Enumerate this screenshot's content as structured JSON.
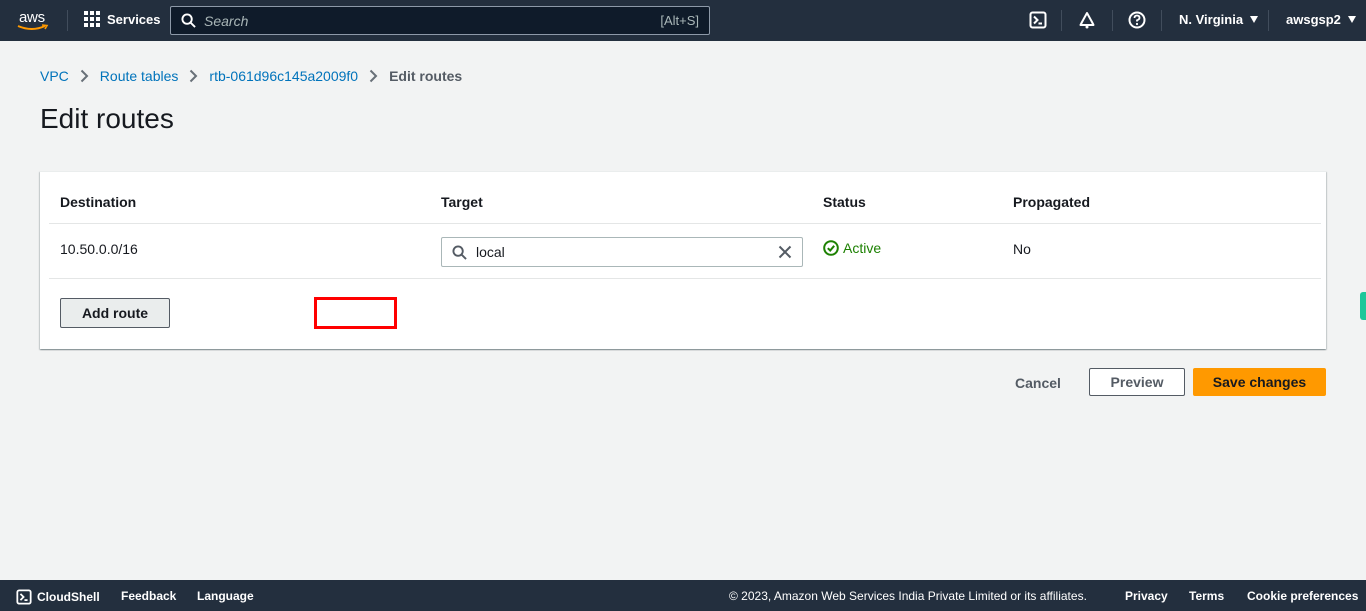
{
  "topnav": {
    "logo_text": "aws",
    "services_label": "Services",
    "search_placeholder": "Search",
    "search_shortcut": "[Alt+S]",
    "icons": [
      "cloudshell-icon",
      "notifications-icon",
      "help-icon"
    ],
    "region_label": "N. Virginia",
    "account_label": "awsgsp2"
  },
  "breadcrumb": {
    "items": [
      "VPC",
      "Route tables",
      "rtb-061d96c145a2009f0"
    ],
    "current": "Edit routes"
  },
  "page": {
    "title": "Edit routes"
  },
  "routes_table": {
    "columns": [
      "Destination",
      "Target",
      "Status",
      "Propagated"
    ],
    "rows": [
      {
        "destination": "10.50.0.0/16",
        "target": "local",
        "status": "Active",
        "propagated": "No"
      }
    ],
    "add_route_label": "Add route"
  },
  "actions": {
    "cancel_label": "Cancel",
    "preview_label": "Preview",
    "save_label": "Save changes"
  },
  "colors": {
    "nav_bg": "#232f3e",
    "link": "#0073bb",
    "status_active": "#1d8102",
    "primary_button": "#ff9900",
    "highlight_box": "#ff0000"
  },
  "footer": {
    "cloudshell_label": "CloudShell",
    "feedback_label": "Feedback",
    "language_label": "Language",
    "copyright": "© 2023, Amazon Web Services India Private Limited or its affiliates.",
    "privacy_label": "Privacy",
    "terms_label": "Terms",
    "cookie_label": "Cookie preferences"
  }
}
